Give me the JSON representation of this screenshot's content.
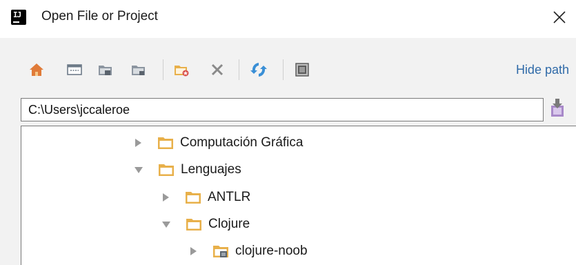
{
  "window": {
    "title": "Open File or Project",
    "logo_text": "IJ",
    "close_glyph": "✕"
  },
  "toolbar": {
    "buttons": [
      {
        "name": "home-icon"
      },
      {
        "name": "desktop-icon"
      },
      {
        "name": "project-folder-icon"
      },
      {
        "name": "module-folder-icon"
      },
      {
        "name": "new-folder-icon"
      },
      {
        "name": "delete-icon"
      },
      {
        "name": "refresh-icon"
      },
      {
        "name": "show-hidden-icon"
      }
    ],
    "hide_path_label": "Hide path"
  },
  "path": {
    "value": "C:\\Users\\jccaleroe"
  },
  "tree": {
    "items": [
      {
        "label": "Computación Gráfica",
        "expanded": false,
        "level": 0,
        "icon": "folder-icon"
      },
      {
        "label": "Lenguajes",
        "expanded": true,
        "level": 0,
        "icon": "folder-icon"
      },
      {
        "label": "ANTLR",
        "expanded": false,
        "level": 1,
        "icon": "folder-icon"
      },
      {
        "label": "Clojure",
        "expanded": true,
        "level": 1,
        "icon": "folder-icon"
      },
      {
        "label": "clojure-noob",
        "expanded": false,
        "level": 2,
        "icon": "project-folder-icon"
      }
    ]
  },
  "colors": {
    "folder_fill": "#e8b04a",
    "folder_inner": "#ffffff",
    "link": "#2f6aa8",
    "refresh": "#3a8fd6"
  }
}
